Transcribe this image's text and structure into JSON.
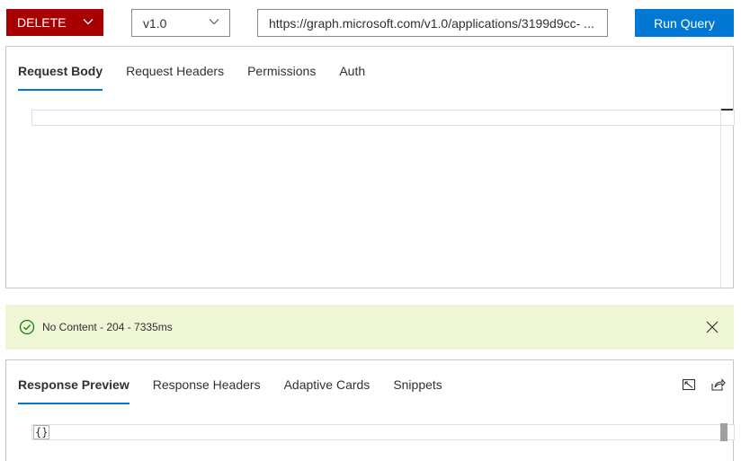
{
  "query": {
    "method": "DELETE",
    "version": "v1.0",
    "url": "https://graph.microsoft.com/v1.0/applications/3199d9cc- ...",
    "run_label": "Run Query"
  },
  "request": {
    "tabs": [
      {
        "label": "Request Body",
        "active": true
      },
      {
        "label": "Request Headers",
        "active": false
      },
      {
        "label": "Permissions",
        "active": false
      },
      {
        "label": "Auth",
        "active": false
      }
    ]
  },
  "status": {
    "text": "No Content - 204 - 7335ms",
    "color": "#eff6d6"
  },
  "response": {
    "tabs": [
      {
        "label": "Response Preview",
        "active": true
      },
      {
        "label": "Response Headers",
        "active": false
      },
      {
        "label": "Adaptive Cards",
        "active": false
      },
      {
        "label": "Snippets",
        "active": false
      }
    ],
    "body": "{}"
  },
  "colors": {
    "method_bg": "#a80000",
    "accent": "#0078d4"
  }
}
